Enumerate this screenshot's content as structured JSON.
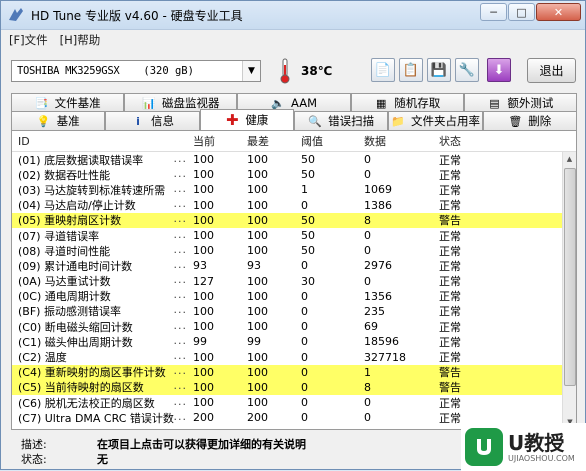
{
  "window": {
    "title": "HD Tune 专业版 v4.60 - 硬盘专业工具",
    "minimize": "─",
    "maximize": "□",
    "close": "✕"
  },
  "menu": [
    "[F]文件",
    "[H]帮助"
  ],
  "toolbar": {
    "drive_model": "TOSHIBA MK3259GSX",
    "drive_size": "(320 gB)",
    "temperature": "38℃",
    "exit_label": "退出",
    "icons": [
      "copy-text-icon",
      "copy-screen-icon",
      "save-icon",
      "options-icon",
      "download-icon"
    ]
  },
  "tabs_top": [
    {
      "label": "文件基准",
      "icon": "file-benchmark-icon"
    },
    {
      "label": "磁盘监视器",
      "icon": "disk-monitor-icon"
    },
    {
      "label": "AAM",
      "icon": "speaker-icon"
    },
    {
      "label": "随机存取",
      "icon": "random-access-icon"
    },
    {
      "label": "额外测试",
      "icon": "extra-tests-icon"
    }
  ],
  "tabs_bottom": [
    {
      "label": "基准",
      "icon": "bulb-icon"
    },
    {
      "label": "信息",
      "icon": "info-icon"
    },
    {
      "label": "健康",
      "icon": "health-cross-icon",
      "active": true
    },
    {
      "label": "错误扫描",
      "icon": "magnifier-icon"
    },
    {
      "label": "文件夹占用率",
      "icon": "folder-icon"
    },
    {
      "label": "删除",
      "icon": "trash-icon"
    }
  ],
  "table": {
    "headers": [
      "ID",
      "当前",
      "最差",
      "阈值",
      "数据",
      "状态"
    ],
    "rows": [
      {
        "id": "(01) 底层数据读取错误率",
        "cur": "100",
        "worst": "100",
        "thr": "50",
        "data": "0",
        "status": "正常",
        "warn": false
      },
      {
        "id": "(02) 数据吞吐性能",
        "cur": "100",
        "worst": "100",
        "thr": "50",
        "data": "0",
        "status": "正常",
        "warn": false
      },
      {
        "id": "(03) 马达旋转到标准转速所需",
        "cur": "100",
        "worst": "100",
        "thr": "1",
        "data": "1069",
        "status": "正常",
        "warn": false
      },
      {
        "id": "(04) 马达启动/停止计数",
        "cur": "100",
        "worst": "100",
        "thr": "0",
        "data": "1386",
        "status": "正常",
        "warn": false
      },
      {
        "id": "(05) 重映射扇区计数",
        "cur": "100",
        "worst": "100",
        "thr": "50",
        "data": "8",
        "status": "警告",
        "warn": true
      },
      {
        "id": "(07) 寻道错误率",
        "cur": "100",
        "worst": "100",
        "thr": "50",
        "data": "0",
        "status": "正常",
        "warn": false
      },
      {
        "id": "(08) 寻道时间性能",
        "cur": "100",
        "worst": "100",
        "thr": "50",
        "data": "0",
        "status": "正常",
        "warn": false
      },
      {
        "id": "(09) 累计通电时间计数",
        "cur": "93",
        "worst": "93",
        "thr": "0",
        "data": "2976",
        "status": "正常",
        "warn": false
      },
      {
        "id": "(0A) 马达重试计数",
        "cur": "127",
        "worst": "100",
        "thr": "30",
        "data": "0",
        "status": "正常",
        "warn": false
      },
      {
        "id": "(0C) 通电周期计数",
        "cur": "100",
        "worst": "100",
        "thr": "0",
        "data": "1356",
        "status": "正常",
        "warn": false
      },
      {
        "id": "(BF) 振动感测错误率",
        "cur": "100",
        "worst": "100",
        "thr": "0",
        "data": "235",
        "status": "正常",
        "warn": false
      },
      {
        "id": "(C0) 断电磁头缩回计数",
        "cur": "100",
        "worst": "100",
        "thr": "0",
        "data": "69",
        "status": "正常",
        "warn": false
      },
      {
        "id": "(C1) 磁头伸出周期计数",
        "cur": "99",
        "worst": "99",
        "thr": "0",
        "data": "18596",
        "status": "正常",
        "warn": false
      },
      {
        "id": "(C2) 温度",
        "cur": "100",
        "worst": "100",
        "thr": "0",
        "data": "327718",
        "status": "正常",
        "warn": false
      },
      {
        "id": "(C4) 重新映射的扇区事件计数",
        "cur": "100",
        "worst": "100",
        "thr": "0",
        "data": "1",
        "status": "警告",
        "warn": true
      },
      {
        "id": "(C5) 当前待映射的扇区数",
        "cur": "100",
        "worst": "100",
        "thr": "0",
        "data": "8",
        "status": "警告",
        "warn": true
      },
      {
        "id": "(C6) 脱机无法校正的扇区数",
        "cur": "100",
        "worst": "100",
        "thr": "0",
        "data": "0",
        "status": "正常",
        "warn": false
      },
      {
        "id": "(C7) Ultra DMA CRC 错误计数",
        "cur": "200",
        "worst": "200",
        "thr": "0",
        "data": "0",
        "status": "正常",
        "warn": false
      }
    ]
  },
  "info": {
    "desc_label": "描述:",
    "desc_value": "在项目上点击可以获得更加详细的有关说明",
    "status_label": "状态:",
    "status_value": "无"
  },
  "watermark": {
    "brand": "U教授",
    "url": "UJIAOSHOU.COM"
  },
  "colors": {
    "warn_row": "#ffff66",
    "logo_green": "#1f9a47"
  }
}
